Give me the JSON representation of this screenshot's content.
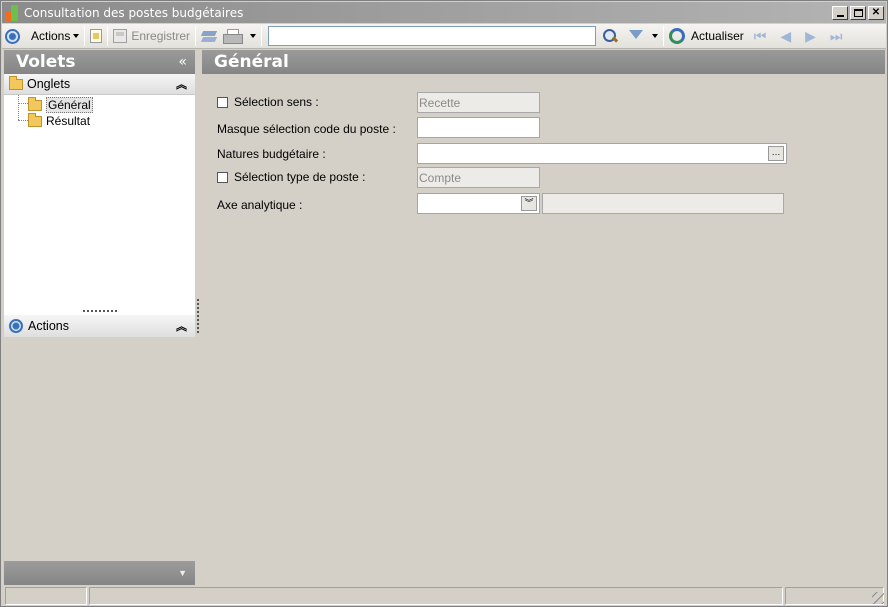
{
  "window": {
    "title": "Consultation des postes budgétaires"
  },
  "toolbar": {
    "actions_label": "Actions",
    "save_label": "Enregistrer",
    "search_value": "",
    "refresh_label": "Actualiser"
  },
  "left_panel": {
    "volets_title": "Volets",
    "collapse_glyph": "«",
    "onglets_label": "Onglets",
    "tree": [
      {
        "label": "Général",
        "selected": true
      },
      {
        "label": "Résultat",
        "selected": false
      }
    ],
    "actions_label": "Actions",
    "expand_glyph": "»"
  },
  "main": {
    "title": "Général",
    "form": {
      "selection_sens_label": "Sélection sens :",
      "selection_sens_value": "Recette",
      "masque_label": "Masque sélection code du poste :",
      "masque_value": "",
      "natures_label": "Natures budgétaire :",
      "natures_value": "",
      "selection_type_label": "Sélection type de poste :",
      "selection_type_value": "Compte",
      "axe_label": "Axe analytique :",
      "axe_value": "",
      "axe_desc_value": ""
    }
  },
  "colors": {
    "header_gray": "#8f8f8f",
    "window_bg": "#d4d0c8"
  }
}
